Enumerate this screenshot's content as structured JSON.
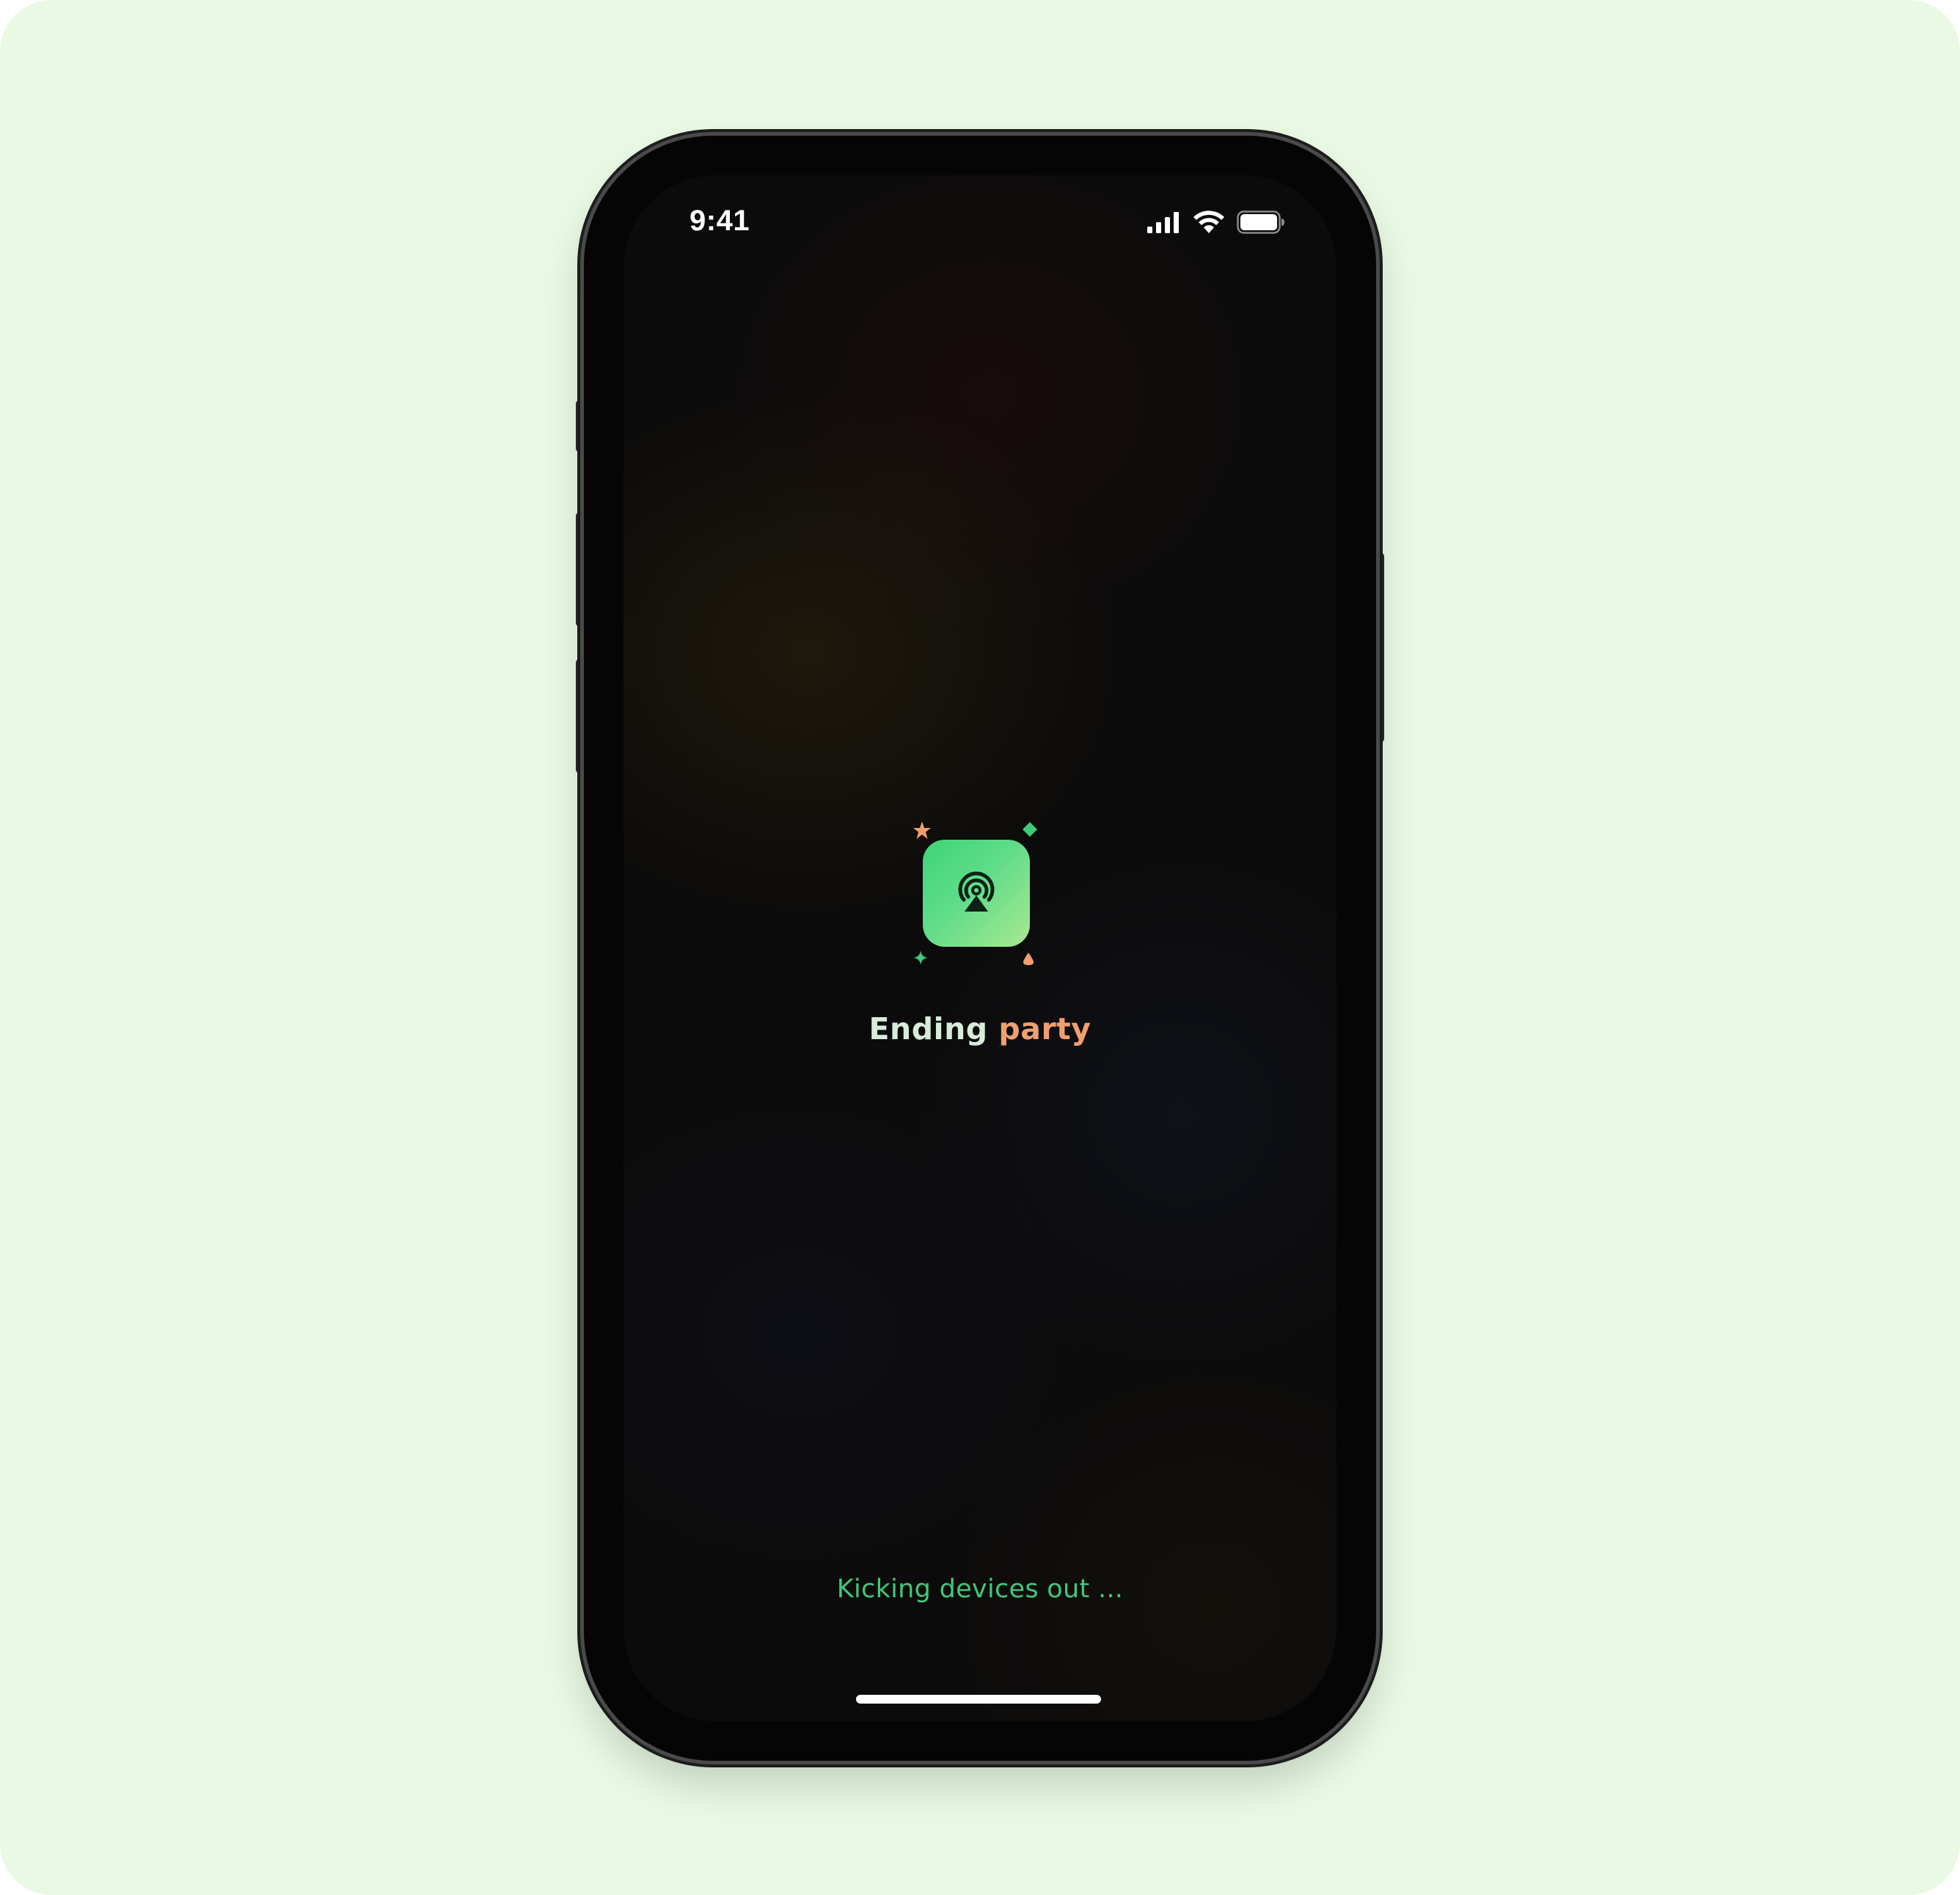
{
  "status_bar": {
    "time": "9:41",
    "signal_icon": "cellular-signal-icon",
    "wifi_icon": "wifi-icon",
    "battery_icon": "battery-icon"
  },
  "main": {
    "app_icon": "party-broadcast-icon",
    "title_part1": "Ending",
    "title_part2": "party",
    "status_message": "Kicking devices out ..."
  },
  "colors": {
    "page_background": "#e9f9e3",
    "screen_background": "#0c0b0b",
    "accent_green": "#3fc97a",
    "accent_orange": "#f0a070",
    "title_light": "#d8ecd9"
  }
}
